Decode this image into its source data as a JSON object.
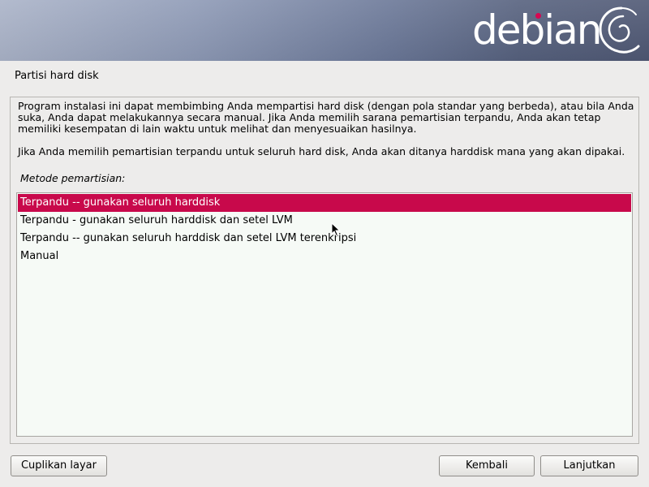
{
  "banner": {
    "logo_text": "debian"
  },
  "section_title": "Partisi hard disk",
  "description": {
    "paragraph1": "Program instalasi ini dapat membimbing Anda mempartisi hard disk (dengan pola standar yang berbeda), atau bila Anda suka, Anda dapat melakukannya secara manual. Jika Anda memilih sarana pemartisian terpandu, Anda akan tetap memiliki kesempatan di lain waktu untuk melihat dan menyesuaikan hasilnya.",
    "paragraph2": "Jika Anda memilih pemartisian terpandu untuk seluruh hard disk, Anda akan ditanya harddisk mana yang akan dipakai."
  },
  "method": {
    "label": "Metode pemartisian:",
    "options": [
      {
        "label": "Terpandu -- gunakan seluruh harddisk",
        "selected": true
      },
      {
        "label": "Terpandu - gunakan seluruh harddisk dan setel LVM",
        "selected": false
      },
      {
        "label": "Terpandu -- gunakan seluruh harddisk dan setel LVM terenkripsi",
        "selected": false
      },
      {
        "label": "Manual",
        "selected": false
      }
    ]
  },
  "buttons": {
    "screenshot": "Cuplikan layar",
    "back": "Kembali",
    "continue": "Lanjutkan"
  },
  "colors": {
    "selection": "#c8094b",
    "logo_dot": "#d70751",
    "background": "#edeceb"
  }
}
